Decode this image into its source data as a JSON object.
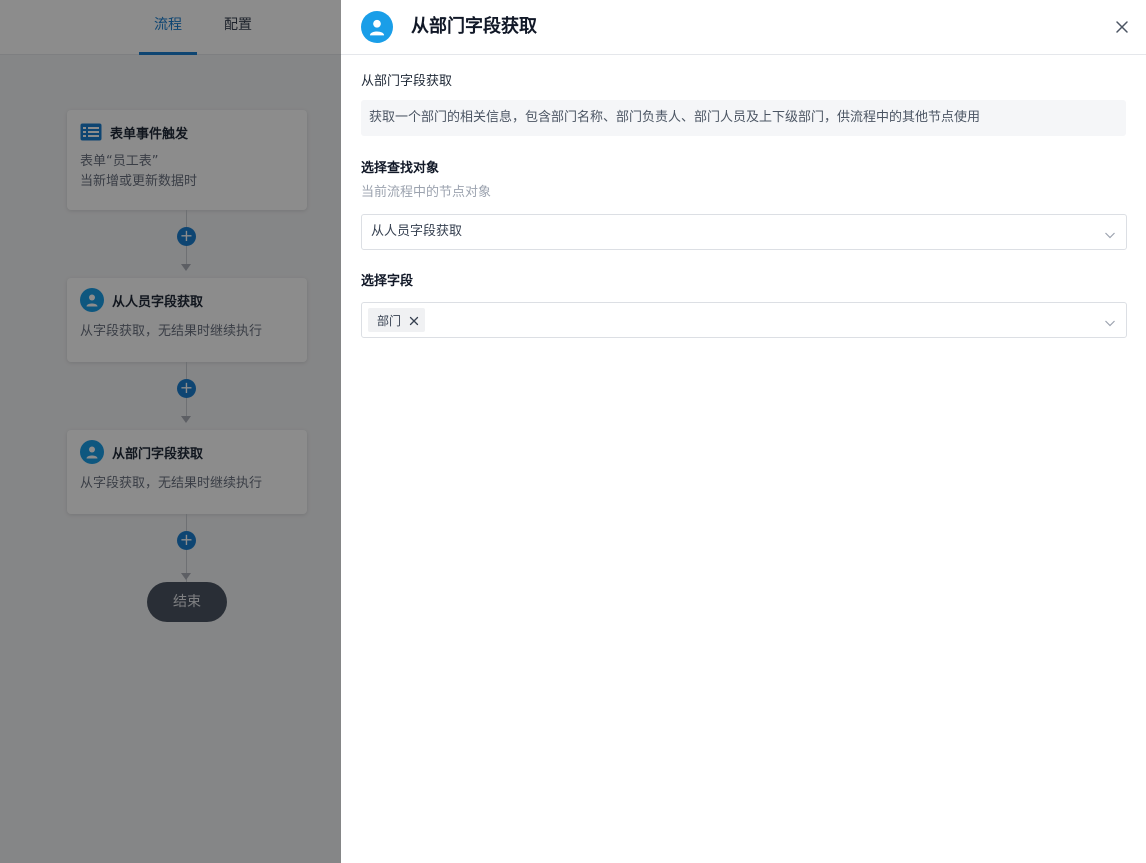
{
  "tabs": [
    {
      "label": "流程",
      "active": true
    },
    {
      "label": "配置",
      "active": false
    }
  ],
  "flow": {
    "trigger": {
      "title": "表单事件触发",
      "line1": "表单“员工表”",
      "line2": "当新增或更新数据时",
      "icon": "table-icon"
    },
    "person_node": {
      "title": "从人员字段获取",
      "desc": "从字段获取，无结果时继续执行",
      "icon": "user-icon"
    },
    "dept_node": {
      "title": "从部门字段获取",
      "desc": "从字段获取，无结果时继续执行",
      "icon": "user-icon"
    },
    "end_label": "结束",
    "add_symbol": "+"
  },
  "drawer": {
    "title": "从部门字段获取",
    "icon": "user-icon",
    "section_label": "从部门字段获取",
    "description": "获取一个部门的相关信息，包含部门名称、部门负责人、部门人员及上下级部门，供流程中的其他节点使用",
    "target_field": {
      "title": "选择查找对象",
      "hint": "当前流程中的节点对象",
      "value": "从人员字段获取"
    },
    "select_field": {
      "title": "选择字段",
      "tags": [
        "部门"
      ]
    }
  },
  "colors": {
    "accent": "#1a7fd0",
    "avatar": "#1a9ee8",
    "end_node": "#4b5563"
  }
}
